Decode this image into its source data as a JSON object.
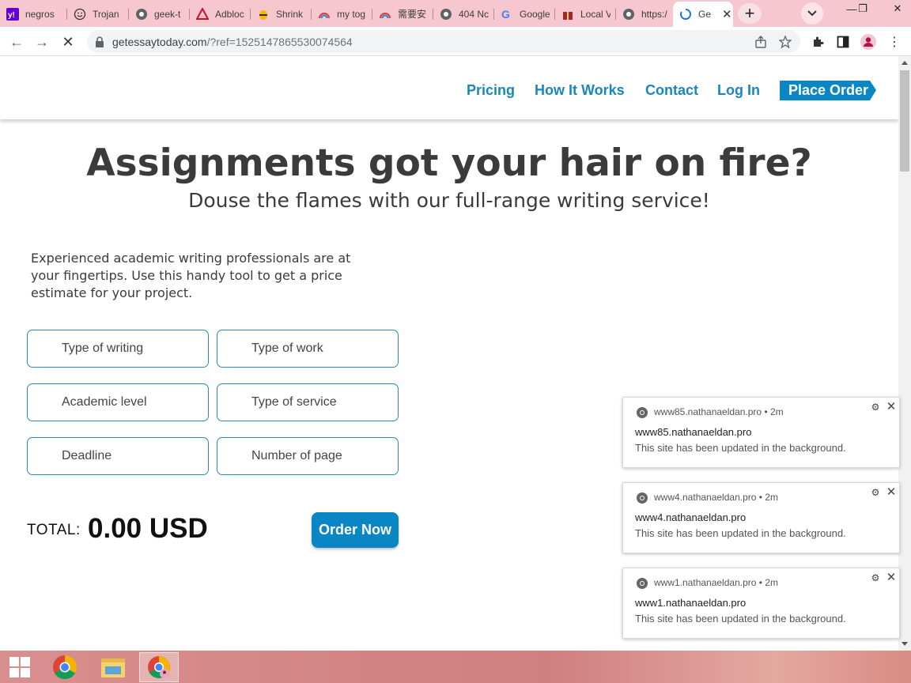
{
  "browser": {
    "tabs": [
      {
        "title": "negros",
        "icon": "yahoo-icon"
      },
      {
        "title": "Trojan",
        "icon": "smiley-icon"
      },
      {
        "title": "geek-t",
        "icon": "globe-icon"
      },
      {
        "title": "Adbloc",
        "icon": "adblock-icon"
      },
      {
        "title": "Shrink",
        "icon": "bee-icon"
      },
      {
        "title": "my tog",
        "icon": "rainbow-icon"
      },
      {
        "title": "需要安",
        "icon": "rainbow-icon"
      },
      {
        "title": "404 Nc",
        "icon": "globe-icon"
      },
      {
        "title": "Google",
        "icon": "google-icon"
      },
      {
        "title": "Local V",
        "icon": "gift-icon"
      },
      {
        "title": "https:/",
        "icon": "globe-icon"
      },
      {
        "title": "Ge",
        "icon": "loading-spinner-icon",
        "active": true
      }
    ],
    "url_host": "getessaytoday.com",
    "url_path": "/?ref=1525147865530074564"
  },
  "site": {
    "nav": {
      "pricing": "Pricing",
      "how_it_works": "How It Works",
      "contact": "Contact",
      "login": "Log In",
      "place_order": "Place Order"
    },
    "hero_title": "Assignments got your hair on fire?",
    "hero_subtitle": "Douse the flames with our full-range writing service!",
    "intro_text": "Experienced academic writing professionals are at your fingertips. Use this handy tool to get a price estimate for your project.",
    "fields": {
      "type_of_writing": "Type of writing",
      "type_of_work": "Type of work",
      "academic_level": "Academic level",
      "type_of_service": "Type of service",
      "deadline": "Deadline",
      "number_of_page": "Number of page"
    },
    "total_label": "TOTAL:",
    "total_value": "0.00 USD",
    "order_now": "Order Now"
  },
  "notifications": [
    {
      "origin": "www85.nathanaeldan.pro",
      "time": "2m",
      "title": "www85.nathanaeldan.pro",
      "body": "This site has been updated in the background."
    },
    {
      "origin": "www4.nathanaeldan.pro",
      "time": "2m",
      "title": "www4.nathanaeldan.pro",
      "body": "This site has been updated in the background."
    },
    {
      "origin": "www1.nathanaeldan.pro",
      "time": "2m",
      "title": "www1.nathanaeldan.pro",
      "body": "This site has been updated in the background."
    }
  ],
  "colors": {
    "brand_blue": "#0b86c4",
    "link_blue": "#1a85be",
    "tabstrip_pink": "#f6c7cf"
  }
}
